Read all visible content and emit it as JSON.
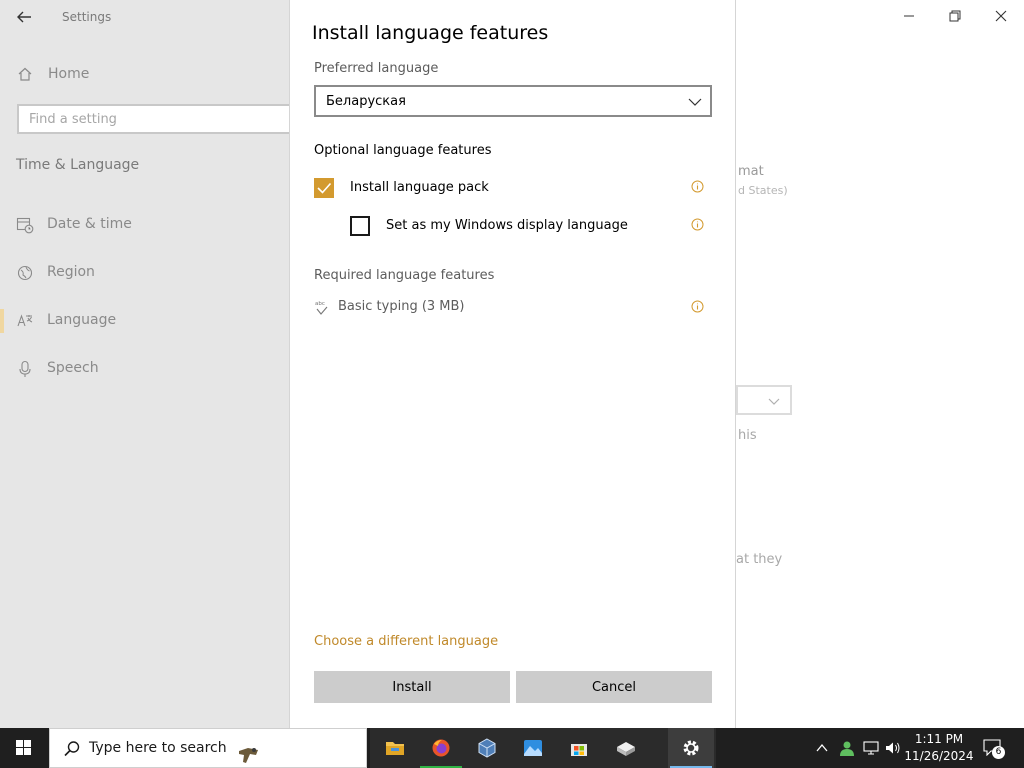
{
  "settings": {
    "app_title": "Settings",
    "home_label": "Home",
    "search_placeholder": "Find a setting",
    "section_title": "Time & Language",
    "nav": [
      {
        "label": "Date & time",
        "icon": "calendar-clock-icon"
      },
      {
        "label": "Region",
        "icon": "globe-icon"
      },
      {
        "label": "Language",
        "icon": "language-icon"
      },
      {
        "label": "Speech",
        "icon": "microphone-icon"
      }
    ],
    "active_nav": "Language",
    "background_fragments": [
      "mat",
      "d States)",
      "his",
      "at they"
    ]
  },
  "dialog": {
    "title": "Install language features",
    "preferred_language_label": "Preferred language",
    "preferred_language_value": "Беларуская",
    "optional_heading": "Optional language features",
    "optional_features": [
      {
        "label": "Install language pack",
        "checked": true
      },
      {
        "label": "Set as my Windows display language",
        "checked": false
      }
    ],
    "required_heading": "Required language features",
    "required_features": [
      {
        "label": "Basic typing (3 MB)",
        "icon": "abc-check-icon"
      }
    ],
    "choose_link": "Choose a different language",
    "install_button": "Install",
    "cancel_button": "Cancel"
  },
  "taskbar": {
    "search_text": "Type here to search",
    "apps": [
      "file-explorer-icon",
      "firefox-icon",
      "virtualbox-icon",
      "photos-icon",
      "microsoft-store-icon",
      "package-icon",
      "settings-gear-icon"
    ],
    "time": "1:11 PM",
    "date": "11/26/2024",
    "notification_count": "6"
  },
  "colors": {
    "accent": "#d39a2f",
    "link": "#c0892a",
    "sidebar_bg": "#e6e6e6",
    "taskbar_bg": "#1f1f1f"
  }
}
